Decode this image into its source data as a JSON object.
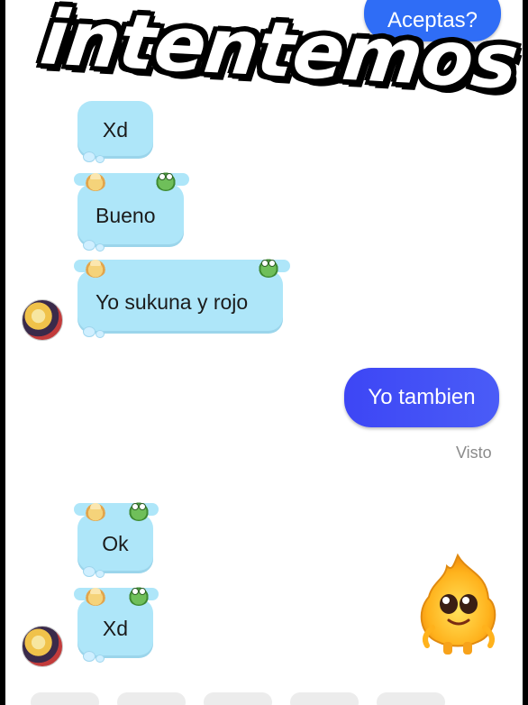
{
  "overlay": {
    "caption": "intentemos"
  },
  "chat": {
    "messages": [
      {
        "id": "m1",
        "direction": "outgoing",
        "text": "Aceptas?"
      },
      {
        "id": "m2",
        "direction": "incoming",
        "text": "Xd"
      },
      {
        "id": "m3",
        "direction": "incoming",
        "text": "Bueno"
      },
      {
        "id": "m4",
        "direction": "incoming",
        "text": "Yo sukuna y rojo"
      },
      {
        "id": "m5",
        "direction": "outgoing",
        "text": "Yo tambien"
      },
      {
        "id": "m6",
        "direction": "incoming",
        "text": "Ok"
      },
      {
        "id": "m7",
        "direction": "incoming",
        "text": "Xd"
      }
    ],
    "seen_label": "Visto"
  },
  "theme": {
    "outgoing_color": "#3d46f5",
    "incoming_color": "#aee6f9",
    "background": "#ffffff"
  },
  "icons": {
    "bubble_decor_left": "cake-icon",
    "bubble_decor_right": "frog-icon",
    "contact_avatar": "contact-avatar",
    "sticker": "flame-mascot-sticker"
  }
}
